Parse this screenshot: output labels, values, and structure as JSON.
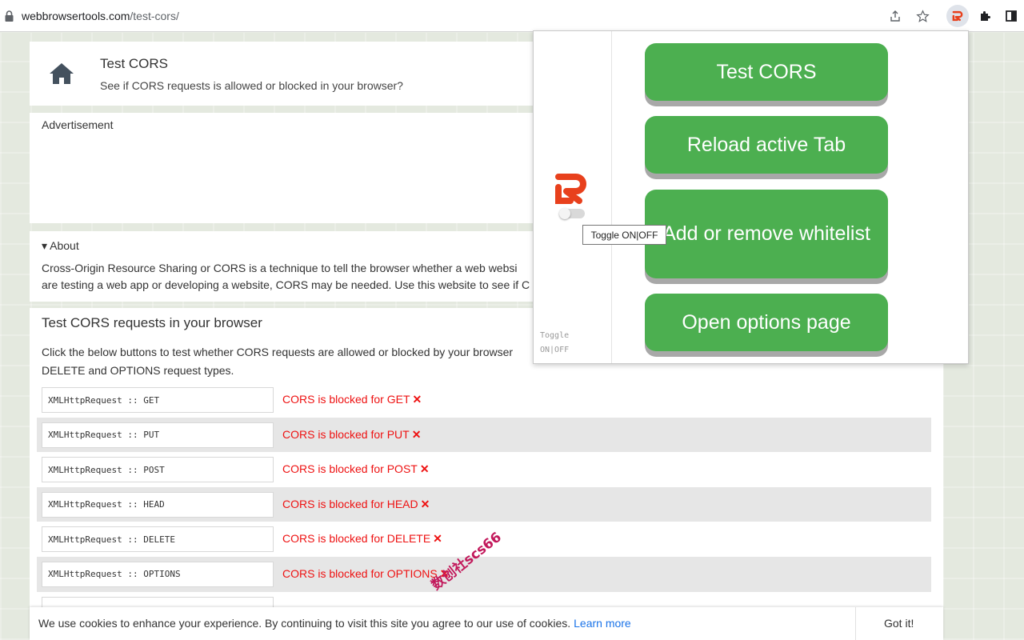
{
  "browser": {
    "url_host": "webbrowsertools.com",
    "url_path": "/test-cors/"
  },
  "header": {
    "title": "Test CORS",
    "subtitle": "See if CORS requests is allowed or blocked in your browser?"
  },
  "ad": {
    "label": "Advertisement"
  },
  "about": {
    "summary": "▾ About",
    "line1": "Cross-Origin Resource Sharing or CORS is a technique to tell the browser whether a web websi",
    "line2": "are testing a web app or developing a website, CORS may be needed. Use this website to see if C"
  },
  "test": {
    "title": "Test CORS requests in your browser",
    "desc_line1": "Click the below buttons to test whether CORS requests are allowed or blocked by your browser",
    "desc_line2": "DELETE and OPTIONS request types.",
    "rows": [
      {
        "button": "XMLHttpRequest :: GET",
        "status": "CORS is blocked for GET"
      },
      {
        "button": "XMLHttpRequest :: PUT",
        "status": "CORS is blocked for PUT"
      },
      {
        "button": "XMLHttpRequest :: POST",
        "status": "CORS is blocked for POST"
      },
      {
        "button": "XMLHttpRequest :: HEAD",
        "status": "CORS is blocked for HEAD"
      },
      {
        "button": "XMLHttpRequest :: DELETE",
        "status": "CORS is blocked for DELETE"
      },
      {
        "button": "XMLHttpRequest :: OPTIONS",
        "status": "CORS is blocked for OPTIONS"
      }
    ],
    "fail_mark": "✕"
  },
  "cookie": {
    "text": "We use cookies to enhance your experience. By continuing to visit this site you agree to our use of cookies.",
    "link": "Learn more",
    "button": "Got it!"
  },
  "popup": {
    "buttons": [
      "Test CORS",
      "Reload active Tab",
      "Add or remove whitelist",
      "Open options page"
    ],
    "toggle_label_line1": "Toggle",
    "toggle_label_line2": "ON|OFF",
    "brand_color": "#e8401c",
    "button_color": "#4caf50"
  },
  "tooltip": {
    "text": "Toggle ON|OFF"
  },
  "watermark": {
    "text": "数创社scs66"
  }
}
